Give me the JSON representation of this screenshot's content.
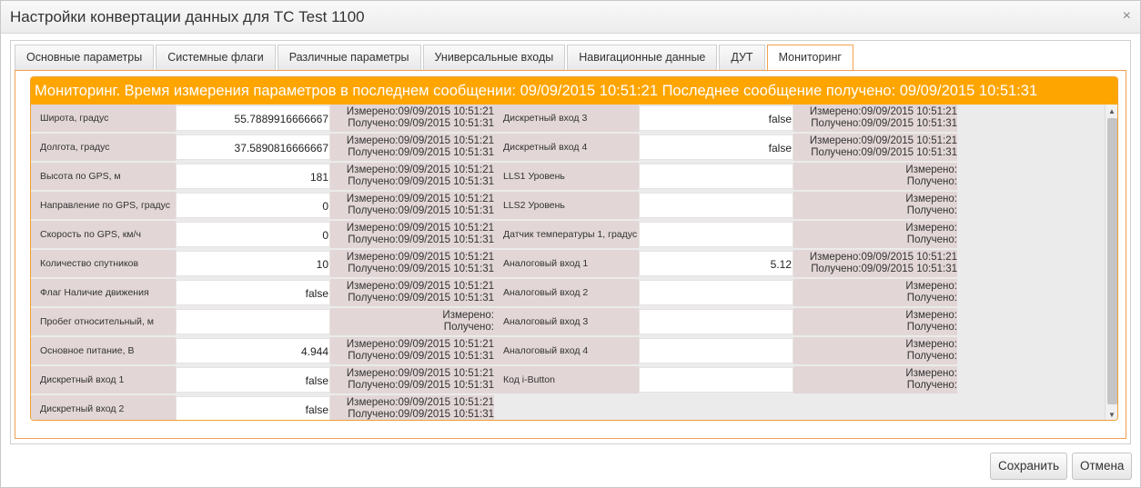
{
  "window": {
    "title": "Настройки конвертации данных для ТС Test 1100",
    "close_glyph": "×"
  },
  "tabs": [
    {
      "label": "Основные параметры"
    },
    {
      "label": "Системные флаги"
    },
    {
      "label": "Различные параметры"
    },
    {
      "label": "Универсальные входы"
    },
    {
      "label": "Навигационные данные"
    },
    {
      "label": "ДУТ"
    },
    {
      "label": "Мониторинг",
      "active": true
    }
  ],
  "monitoring": {
    "banner": "Мониторинг. Время измерения параметров в последнем сообщении: 09/09/2015 10:51:21 Последнее сообщение получено: 09/09/2015 10:51:31",
    "left_params": [
      {
        "label": "Широта, градус",
        "value": "55.7889916666667",
        "measured": "Измерено:09/09/2015 10:51:21",
        "received": "Получено:09/09/2015 10:51:31"
      },
      {
        "label": "Долгота, градус",
        "value": "37.5890816666667",
        "measured": "Измерено:09/09/2015 10:51:21",
        "received": "Получено:09/09/2015 10:51:31"
      },
      {
        "label": "Высота по GPS, м",
        "value": "181",
        "measured": "Измерено:09/09/2015 10:51:21",
        "received": "Получено:09/09/2015 10:51:31"
      },
      {
        "label": "Направление по GPS, градус",
        "value": "0",
        "measured": "Измерено:09/09/2015 10:51:21",
        "received": "Получено:09/09/2015 10:51:31"
      },
      {
        "label": "Скорость по GPS, км/ч",
        "value": "0",
        "measured": "Измерено:09/09/2015 10:51:21",
        "received": "Получено:09/09/2015 10:51:31"
      },
      {
        "label": "Количество спутников",
        "value": "10",
        "measured": "Измерено:09/09/2015 10:51:21",
        "received": "Получено:09/09/2015 10:51:31"
      },
      {
        "label": "Флаг Наличие движения",
        "value": "false",
        "measured": "Измерено:09/09/2015 10:51:21",
        "received": "Получено:09/09/2015 10:51:31"
      },
      {
        "label": "Пробег относительный, м",
        "value": "",
        "measured": "Измерено:",
        "received": "Получено:"
      },
      {
        "label": "Основное питание, В",
        "value": "4.944",
        "measured": "Измерено:09/09/2015 10:51:21",
        "received": "Получено:09/09/2015 10:51:31"
      },
      {
        "label": "Дискретный вход 1",
        "value": "false",
        "measured": "Измерено:09/09/2015 10:51:21",
        "received": "Получено:09/09/2015 10:51:31"
      },
      {
        "label": "Дискретный вход 2",
        "value": "false",
        "measured": "Измерено:09/09/2015 10:51:21",
        "received": "Получено:09/09/2015 10:51:31"
      }
    ],
    "right_params": [
      {
        "label": "Дискретный вход 3",
        "value": "false",
        "measured": "Измерено:09/09/2015 10:51:21",
        "received": "Получено:09/09/2015 10:51:31"
      },
      {
        "label": "Дискретный вход 4",
        "value": "false",
        "measured": "Измерено:09/09/2015 10:51:21",
        "received": "Получено:09/09/2015 10:51:31"
      },
      {
        "label": "LLS1 Уровень",
        "value": "",
        "measured": "Измерено:",
        "received": "Получено:"
      },
      {
        "label": "LLS2 Уровень",
        "value": "",
        "measured": "Измерено:",
        "received": "Получено:"
      },
      {
        "label": "Датчик температуры 1, градус",
        "value": "",
        "measured": "Измерено:",
        "received": "Получено:"
      },
      {
        "label": "Аналоговый вход 1",
        "value": "5.12",
        "measured": "Измерено:09/09/2015 10:51:21",
        "received": "Получено:09/09/2015 10:51:31"
      },
      {
        "label": "Аналоговый вход 2",
        "value": "",
        "measured": "Измерено:",
        "received": "Получено:"
      },
      {
        "label": "Аналоговый вход 3",
        "value": "",
        "measured": "Измерено:",
        "received": "Получено:"
      },
      {
        "label": "Аналоговый вход 4",
        "value": "",
        "measured": "Измерено:",
        "received": "Получено:"
      },
      {
        "label": "Код i-Button",
        "value": "",
        "measured": "Измерено:",
        "received": "Получено:"
      }
    ]
  },
  "scrollbar": {
    "up_glyph": "▲",
    "down_glyph": "▼"
  },
  "footer": {
    "save_label": "Сохранить",
    "cancel_label": "Отмена"
  },
  "colors": {
    "banner": "#ffa500",
    "label_bg": "#e2d6d6",
    "accent_border": "#f0a050"
  }
}
